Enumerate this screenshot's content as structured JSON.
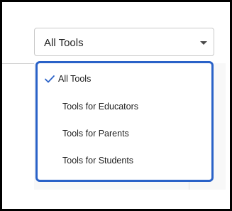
{
  "tool_filter": {
    "selected_value": "All Tools",
    "accent_color": "#2a62c8",
    "options": [
      {
        "label": "All Tools",
        "selected": true,
        "icon": "check-icon"
      },
      {
        "label": "Tools for Educators",
        "selected": false
      },
      {
        "label": "Tools for Parents",
        "selected": false
      },
      {
        "label": "Tools for Students",
        "selected": false
      }
    ]
  }
}
